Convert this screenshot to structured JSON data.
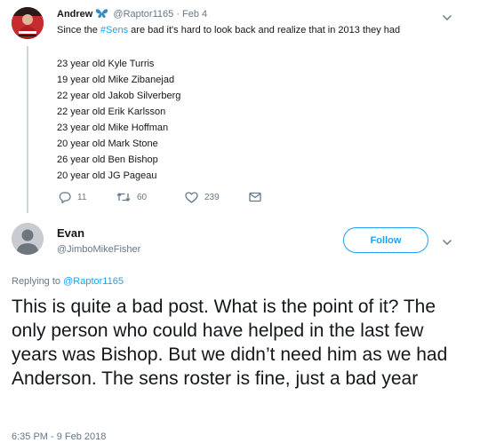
{
  "parent_tweet": {
    "name": "Andrew",
    "handle": "@Raptor1165",
    "separator": "·",
    "date": "Feb 4",
    "text_before": "Since the ",
    "hashtag": "#Sens",
    "text_after": " are bad it's hard to look back and realize that in 2013 they had",
    "list": [
      "23 year old Kyle Turris",
      "19 year old Mike Zibanejad",
      "22 year old Jakob Silverberg",
      "22 year old Erik Karlsson",
      "23 year old Mike Hoffman",
      "20 year old Mark Stone",
      "26 year old Ben Bishop",
      "20 year old JG Pageau"
    ],
    "actions": {
      "replies": "11",
      "retweets": "60",
      "likes": "239"
    }
  },
  "main_tweet": {
    "name": "Evan",
    "handle": "@JimboMikeFisher",
    "follow_label": "Follow",
    "replying_prefix": "Replying to ",
    "replying_to": "@Raptor1165",
    "text": "This is quite a bad post. What is the point of it? The only person who could have helped in the last few years was Bishop. But we didn’t need him as we had Anderson. The sens roster is fine, just a bad year",
    "timestamp": "6:35 PM - 9 Feb 2018"
  },
  "colors": {
    "accent": "#1da1f2",
    "muted": "#657786",
    "text": "#14171a",
    "thread_line": "#ccd6dd"
  },
  "icons": [
    "butterfly-icon",
    "chevron-down-icon",
    "reply-icon",
    "retweet-icon",
    "like-icon",
    "direct-message-icon",
    "default-avatar-icon"
  ]
}
